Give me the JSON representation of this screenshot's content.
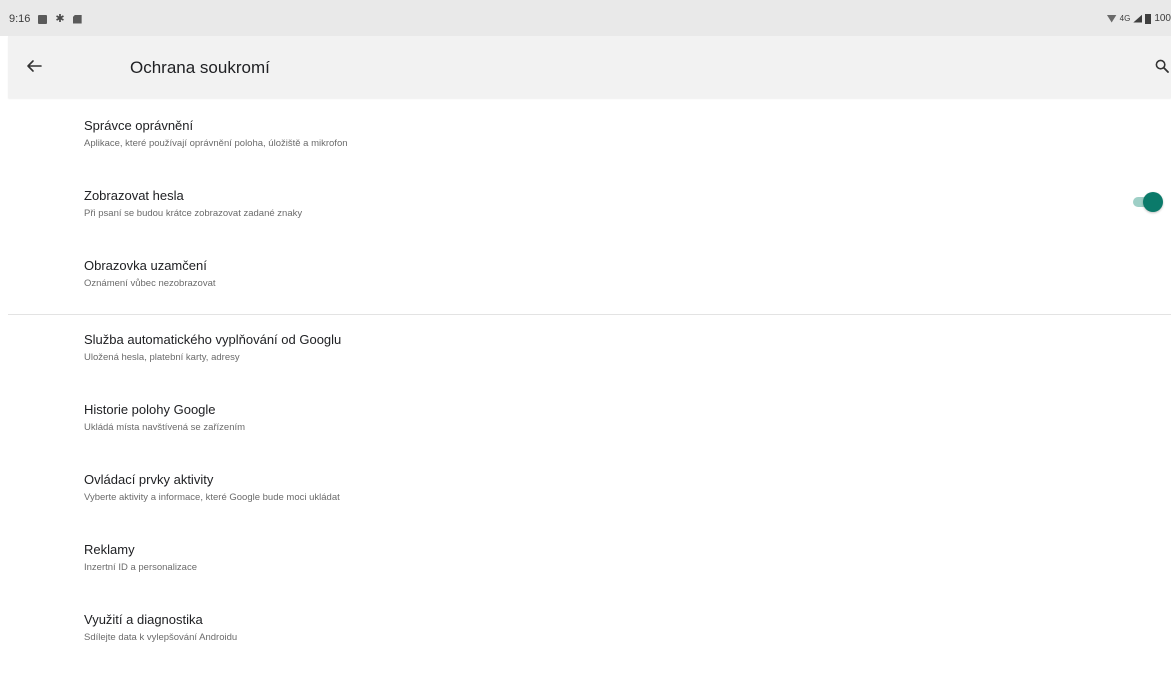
{
  "status_bar": {
    "time": "9:16",
    "left_icons": [
      "message-icon",
      "gear-icon",
      "sd-card-icon"
    ],
    "network": "4G",
    "battery": "100"
  },
  "app_bar": {
    "title": "Ochrana soukromí",
    "back_icon": "arrow-left-icon",
    "search_icon": "search-icon"
  },
  "items": [
    {
      "title": "Správce oprávnění",
      "subtitle": "Aplikace, které používají oprávnění poloha, úložiště a mikrofon"
    },
    {
      "title": "Zobrazovat hesla",
      "subtitle": "Při psaní se budou krátce zobrazovat zadané znaky",
      "toggle_on": true
    },
    {
      "title": "Obrazovka uzamčení",
      "subtitle": "Oznámení vůbec nezobrazovat"
    },
    {
      "title": "Služba automatického vyplňování od Googlu",
      "subtitle": "Uložená hesla, platební karty, adresy"
    },
    {
      "title": "Historie polohy Google",
      "subtitle": "Ukládá místa navštívená se zařízením"
    },
    {
      "title": "Ovládací prvky aktivity",
      "subtitle": "Vyberte aktivity a informace, které Google bude moci ukládat"
    },
    {
      "title": "Reklamy",
      "subtitle": "Inzertní ID a personalizace"
    },
    {
      "title": "Využití a diagnostika",
      "subtitle": "Sdílejte data k vylepšování Androidu"
    }
  ],
  "colors": {
    "accent": "#0b7a6a",
    "app_bar_bg": "#f2f2f2",
    "status_bar_bg": "#e9e9e9"
  }
}
